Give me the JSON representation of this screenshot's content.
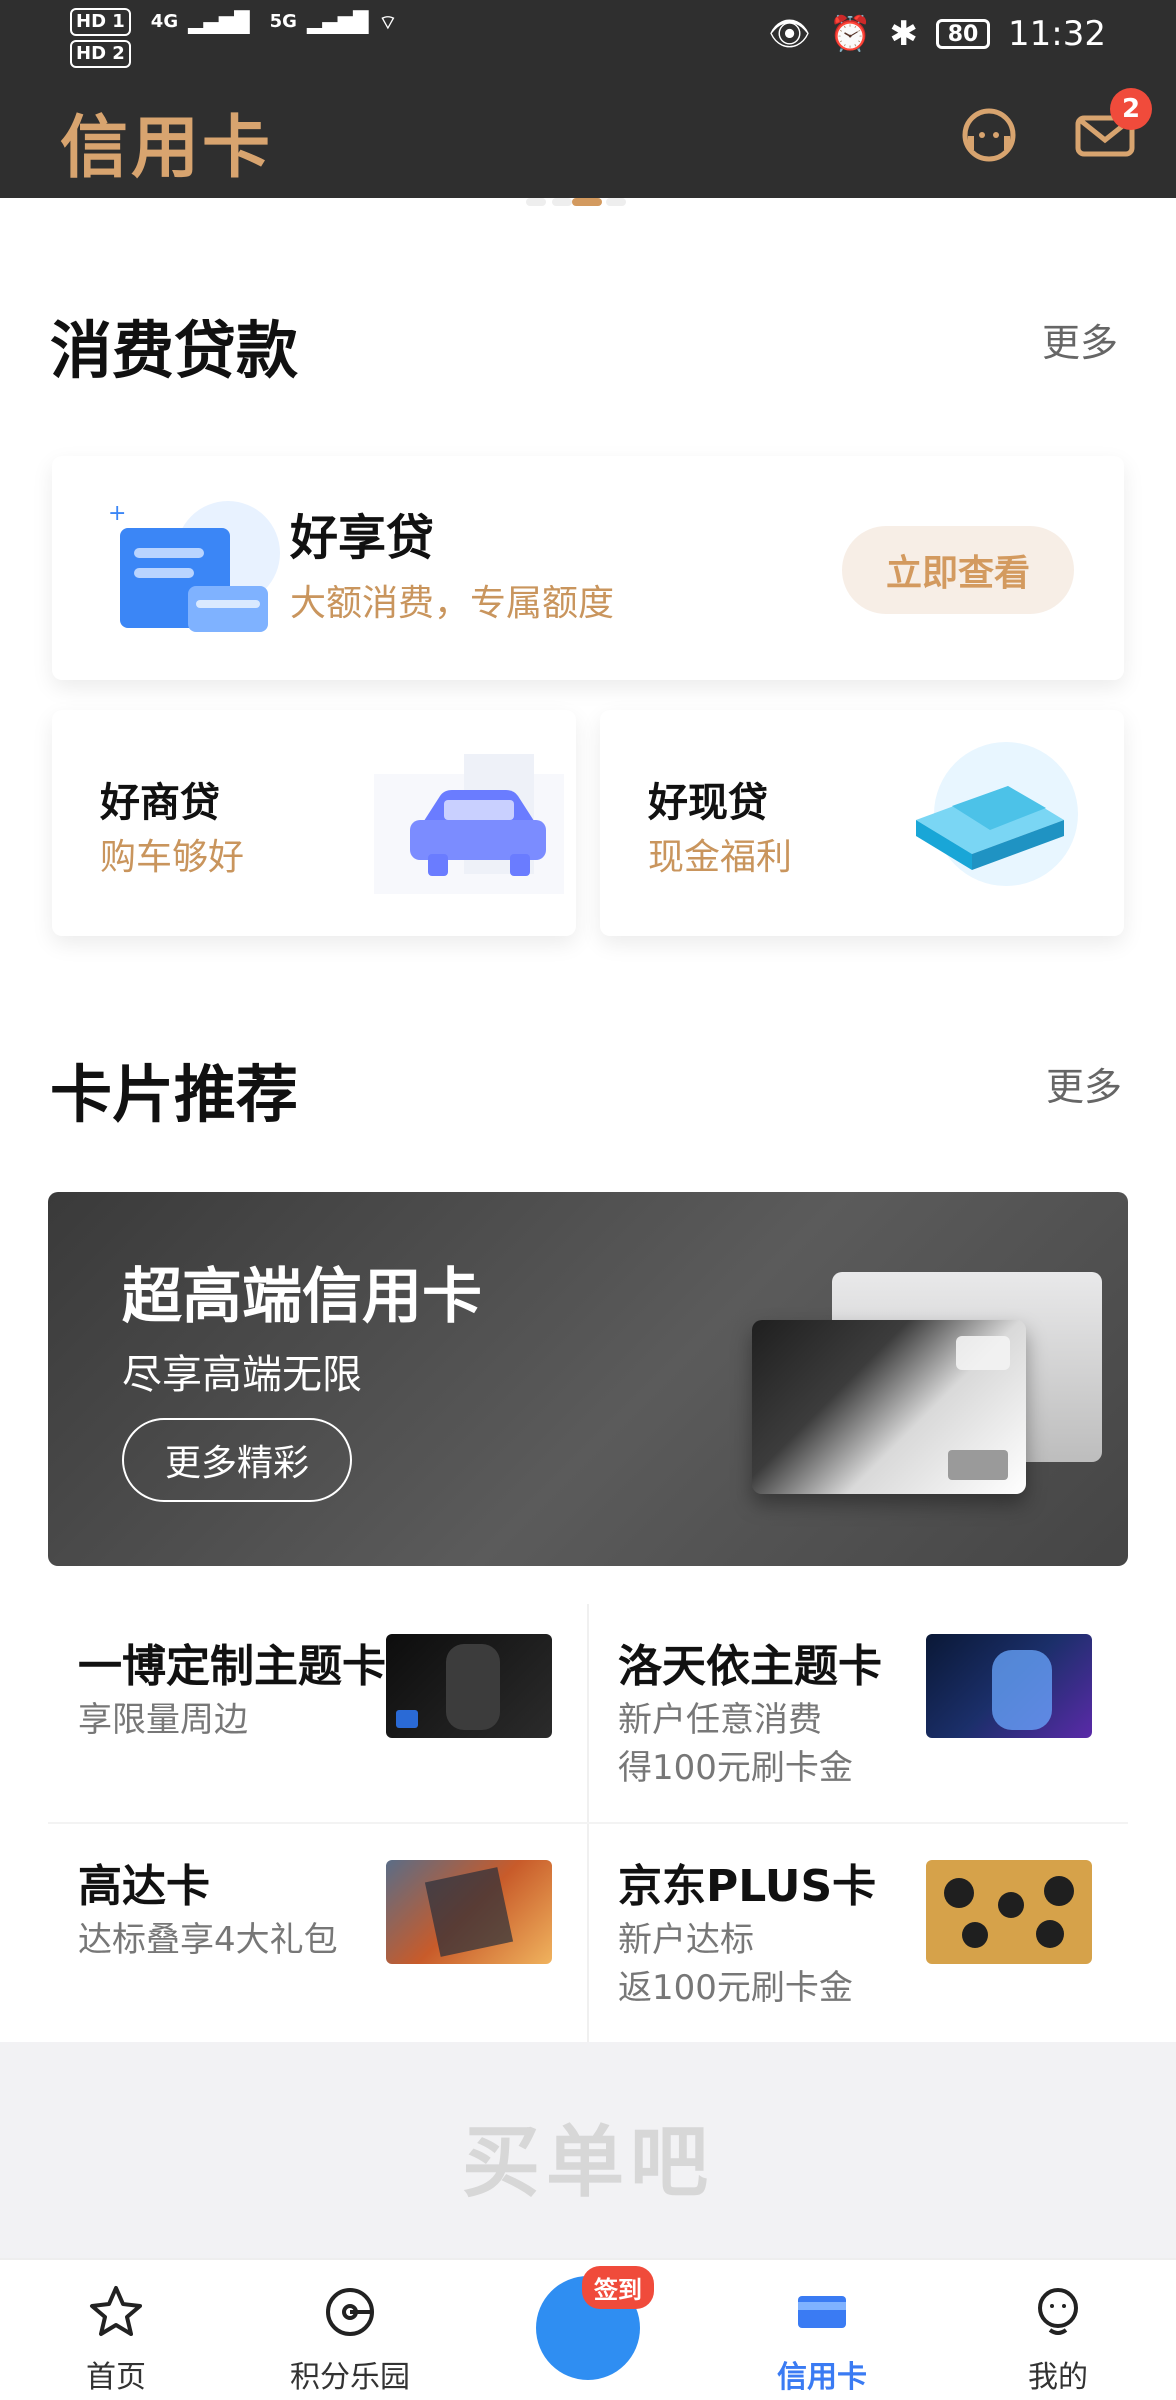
{
  "status_bar": {
    "hd1": "HD 1",
    "hd2": "HD 2",
    "net1": "4G",
    "net2": "5G",
    "battery": "80",
    "time": "11:32"
  },
  "header": {
    "title": "信用卡",
    "message_badge": "2",
    "icons": [
      "customer-service-icon",
      "mail-icon"
    ],
    "brand_color": "#d8a46f"
  },
  "consumer_loans": {
    "title": "消费贷款",
    "more": "更多",
    "featured": {
      "title": "好享贷",
      "subtitle": "大额消费，专属额度",
      "button": "立即查看"
    },
    "small": [
      {
        "title": "好商贷",
        "subtitle": "购车够好"
      },
      {
        "title": "好现贷",
        "subtitle": "现金福利"
      }
    ]
  },
  "card_recommend": {
    "title": "卡片推荐",
    "more": "更多",
    "banner": {
      "title": "超高端信用卡",
      "subtitle": "尽享高端无限",
      "button": "更多精彩"
    },
    "items": [
      {
        "title": "一博定制主题卡",
        "subtitle": "享限量周边"
      },
      {
        "title": "洛天依主题卡",
        "subtitle": "新户任意消费\n得100元刷卡金"
      },
      {
        "title": "高达卡",
        "subtitle": "达标叠享4大礼包"
      },
      {
        "title": "京东PLUS卡",
        "subtitle": "新户达标\n返100元刷卡金"
      }
    ]
  },
  "footer_brand": "买单吧",
  "tabbar": {
    "tabs": [
      {
        "label": "首页"
      },
      {
        "label": "积分乐园"
      },
      {
        "label": "信用卡"
      },
      {
        "label": "我的"
      }
    ],
    "center_badge": "签到",
    "active_color": "#3a7bf3"
  }
}
